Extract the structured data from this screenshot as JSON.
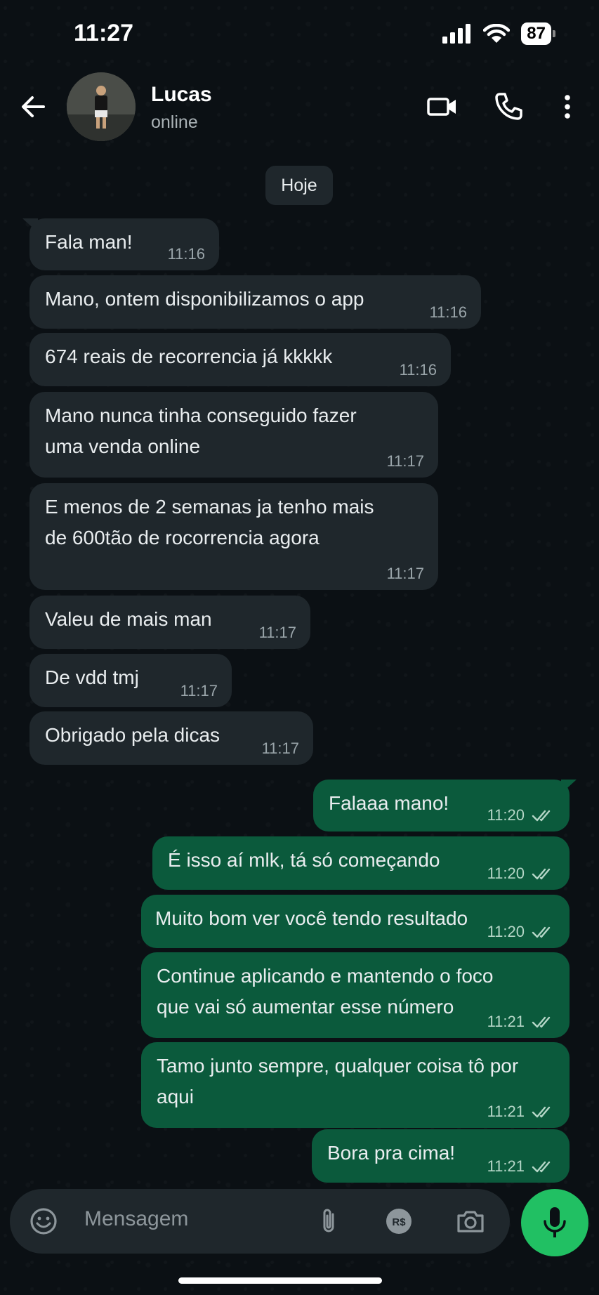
{
  "status_bar": {
    "time": "11:27",
    "battery": "87"
  },
  "contact": {
    "name": "Lucas",
    "status": "online"
  },
  "date_chip": "Hoje",
  "messages": [
    {
      "dir": "in",
      "text": "Fala man!",
      "time": "11:16"
    },
    {
      "dir": "in",
      "text": "Mano, ontem disponibilizamos o app",
      "time": "11:16"
    },
    {
      "dir": "in",
      "text": "674 reais de recorrencia já kkkkk",
      "time": "11:16"
    },
    {
      "dir": "in",
      "text": "Mano nunca tinha conseguido fazer uma venda online",
      "time": "11:17"
    },
    {
      "dir": "in",
      "text": "E menos de 2 semanas ja tenho mais de 600tão de rocorrencia agora",
      "time": "11:17"
    },
    {
      "dir": "in",
      "text": "Valeu de mais man",
      "time": "11:17"
    },
    {
      "dir": "in",
      "text": "De vdd tmj",
      "time": "11:17"
    },
    {
      "dir": "in",
      "text": "Obrigado pela dicas",
      "time": "11:17"
    },
    {
      "dir": "out",
      "text": "Falaaa mano!",
      "time": "11:20"
    },
    {
      "dir": "out",
      "text": "É isso aí mlk, tá só começando",
      "time": "11:20"
    },
    {
      "dir": "out",
      "text": "Muito bom ver você tendo resultado",
      "time": "11:20"
    },
    {
      "dir": "out",
      "text": "Continue aplicando e mantendo o foco que vai só aumentar esse número",
      "time": "11:21"
    },
    {
      "dir": "out",
      "text": "Tamo junto sempre, qualquer coisa tô por aqui",
      "time": "11:21"
    },
    {
      "dir": "out",
      "text": "Bora pra cima!",
      "time": "11:21"
    }
  ],
  "composer": {
    "placeholder": "Mensagem"
  },
  "icons": {
    "back": "arrow-left-icon",
    "video": "video-call-icon",
    "call": "phone-icon",
    "menu": "more-vertical-icon",
    "emoji": "emoji-icon",
    "attach": "paperclip-icon",
    "payment": "real-currency-icon",
    "camera": "camera-icon",
    "mic": "microphone-icon"
  },
  "colors": {
    "incoming_bubble": "#1f272c",
    "outgoing_bubble": "#0b5a3c",
    "accent": "#21c063",
    "background": "#0b1014"
  }
}
